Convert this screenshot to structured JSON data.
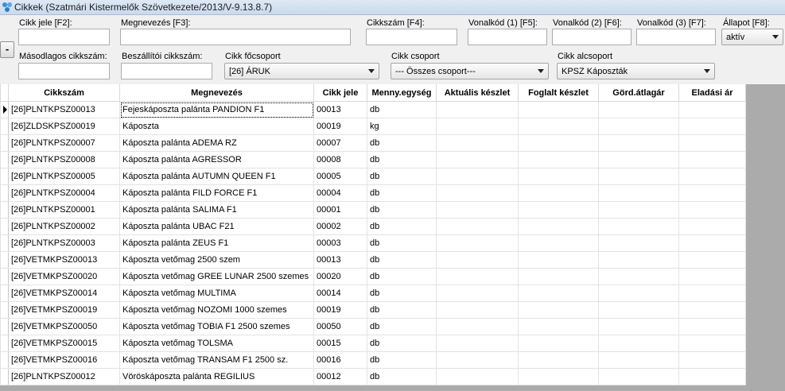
{
  "window": {
    "title": "Cikkek (Szatmári Kistermelők Szövetkezete/2013/V-9.13.8.7)"
  },
  "filters": {
    "collapse_label": "-",
    "cikk_jele_label": "Cikk jele [F2]:",
    "megnevezes_label": "Megnevezés [F3]:",
    "cikkszam_label": "Cikkszám [F4]:",
    "vonalkod1_label": "Vonalkód (1) [F5]:",
    "vonalkod2_label": "Vonalkód (2) [F6]:",
    "vonalkod3_label": "Vonalkód (3) [F7]:",
    "allapot_label": "Állapot [F8]:",
    "allapot_value": "aktív",
    "masodlagos_label": "Másodlagos cikkszám:",
    "beszallitoi_label": "Beszállítói cikkszám:",
    "focsoport_label": "Cikk főcsoport",
    "focsoport_value": "[26] ÁRUK",
    "csoport_label": "Cikk csoport",
    "csoport_value": "--- Összes csoport---",
    "alcsoport_label": "Cikk alcsoport",
    "alcsoport_value": "KPSZ Káposzták"
  },
  "grid": {
    "columns": [
      "Cikkszám",
      "Megnevezés",
      "Cikk jele",
      "Menny.egység",
      "Aktuális készlet",
      "Foglalt készlet",
      "Görd.átlagár",
      "Eladási ár"
    ],
    "rows": [
      [
        "[26]PLNTKPSZ00013",
        "Fejeskáposzta palánta PANDION F1",
        "00013",
        "db"
      ],
      [
        "[26]ZLDSKPSZ00019",
        "Káposzta",
        "00019",
        "kg"
      ],
      [
        "[26]PLNTKPSZ00007",
        "Káposzta palánta ADEMA RZ",
        "00007",
        "db"
      ],
      [
        "[26]PLNTKPSZ00008",
        "Káposzta palánta AGRESSOR",
        "00008",
        "db"
      ],
      [
        "[26]PLNTKPSZ00005",
        "Káposzta palánta AUTUMN QUEEN F1",
        "00005",
        "db"
      ],
      [
        "[26]PLNTKPSZ00004",
        "Káposzta palánta FILD FORCE F1",
        "00004",
        "db"
      ],
      [
        "[26]PLNTKPSZ00001",
        "Káposzta palánta SALIMA F1",
        "00001",
        "db"
      ],
      [
        "[26]PLNTKPSZ00002",
        "Káposzta palánta UBAC F21",
        "00002",
        "db"
      ],
      [
        "[26]PLNTKPSZ00003",
        "Káposzta palánta ZEUS F1",
        "00003",
        "db"
      ],
      [
        "[26]VETMKPSZ00013",
        "Káposzta vetőmag 2500 szem",
        "00013",
        "db"
      ],
      [
        "[26]VETMKPSZ00020",
        "Káposzta vetőmag GREE LUNAR 2500 szemes",
        "00020",
        "db"
      ],
      [
        "[26]VETMKPSZ00014",
        "Káposzta vetőmag MULTIMA",
        "00014",
        "db"
      ],
      [
        "[26]VETMKPSZ00019",
        "Káposzta vetőmag NOZOMI 1000 szemes",
        "00019",
        "db"
      ],
      [
        "[26]VETMKPSZ00050",
        "Káposzta vetőmag TOBIA F1 2500 szemes",
        "00050",
        "db"
      ],
      [
        "[26]VETMKPSZ00015",
        "Káposzta vetőmag TOLSMA",
        "00015",
        "db"
      ],
      [
        "[26]VETMKPSZ00016",
        "Káposzta vetőmag TRANSAM F1 2500 sz.",
        "00016",
        "db"
      ],
      [
        "[26]PLNTKPSZ00012",
        "Vöröskáposzta palánta REGILIUS",
        "00012",
        "db"
      ]
    ]
  }
}
